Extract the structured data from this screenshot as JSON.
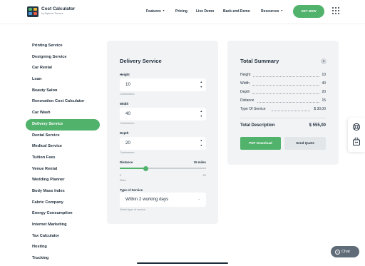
{
  "brand": {
    "title": "Cost Calculator",
    "subtitle": "by Stylemix Themes",
    "accent_color": "#51b26c"
  },
  "nav": {
    "items": [
      {
        "label": "Features",
        "dropdown": true
      },
      {
        "label": "Pricing",
        "dropdown": false
      },
      {
        "label": "Live Demo",
        "dropdown": false
      },
      {
        "label": "Back-end Demo",
        "dropdown": false
      },
      {
        "label": "Resources",
        "dropdown": true
      }
    ],
    "cta_label": "GET NOW",
    "menu_icon": "grid-icon"
  },
  "sidebar": {
    "active_index": 7,
    "items": [
      "Printing Service",
      "Designing Service",
      "Car Rental",
      "Loan",
      "Beauty Salon",
      "Renovation Cost Calculator",
      "Car Wash",
      "Delivery Service",
      "Dental Service",
      "Medical Service",
      "Tuition Fees",
      "Venue Rental",
      "Wedding Planner",
      "Body Mass Index",
      "Fabric Company",
      "Energy Consumption",
      "Internet Marketing",
      "Tax Calculator",
      "Hosting",
      "Trucking"
    ]
  },
  "calculator": {
    "title": "Delivery Service",
    "height": {
      "label": "Height",
      "value": "10",
      "hint": "Centimeters"
    },
    "width": {
      "label": "Width",
      "value": "40",
      "hint": "Centimeters"
    },
    "depth": {
      "label": "Depth",
      "value": "20",
      "hint": "Centimeters"
    },
    "distance": {
      "label": "Distance",
      "value_text": "15 miles",
      "value": 15,
      "min_label": "0",
      "max_label": "50",
      "min": 0,
      "max": 50,
      "unit_hint": "Miles"
    },
    "service_type": {
      "label": "Type of Service",
      "selected": "Within 2 working days",
      "hint": "Select type of service"
    }
  },
  "summary": {
    "title": "Total Summary",
    "rows": [
      {
        "label": "Height",
        "value": "10"
      },
      {
        "label": "Width",
        "value": "40"
      },
      {
        "label": "Depth",
        "value": "20"
      },
      {
        "label": "Distance",
        "value": "15"
      },
      {
        "label": "Type Of Service",
        "value": "$ 30,00"
      }
    ],
    "total_label": "Total Description",
    "total_value": "$ 555,00",
    "pdf_label": "PDF Download",
    "quote_label": "Send Quote"
  },
  "widgets": {
    "chat_label": "Chat",
    "chat_icon_glyph": "?",
    "float_icons": [
      "lifebuoy-icon",
      "cart-icon"
    ]
  }
}
